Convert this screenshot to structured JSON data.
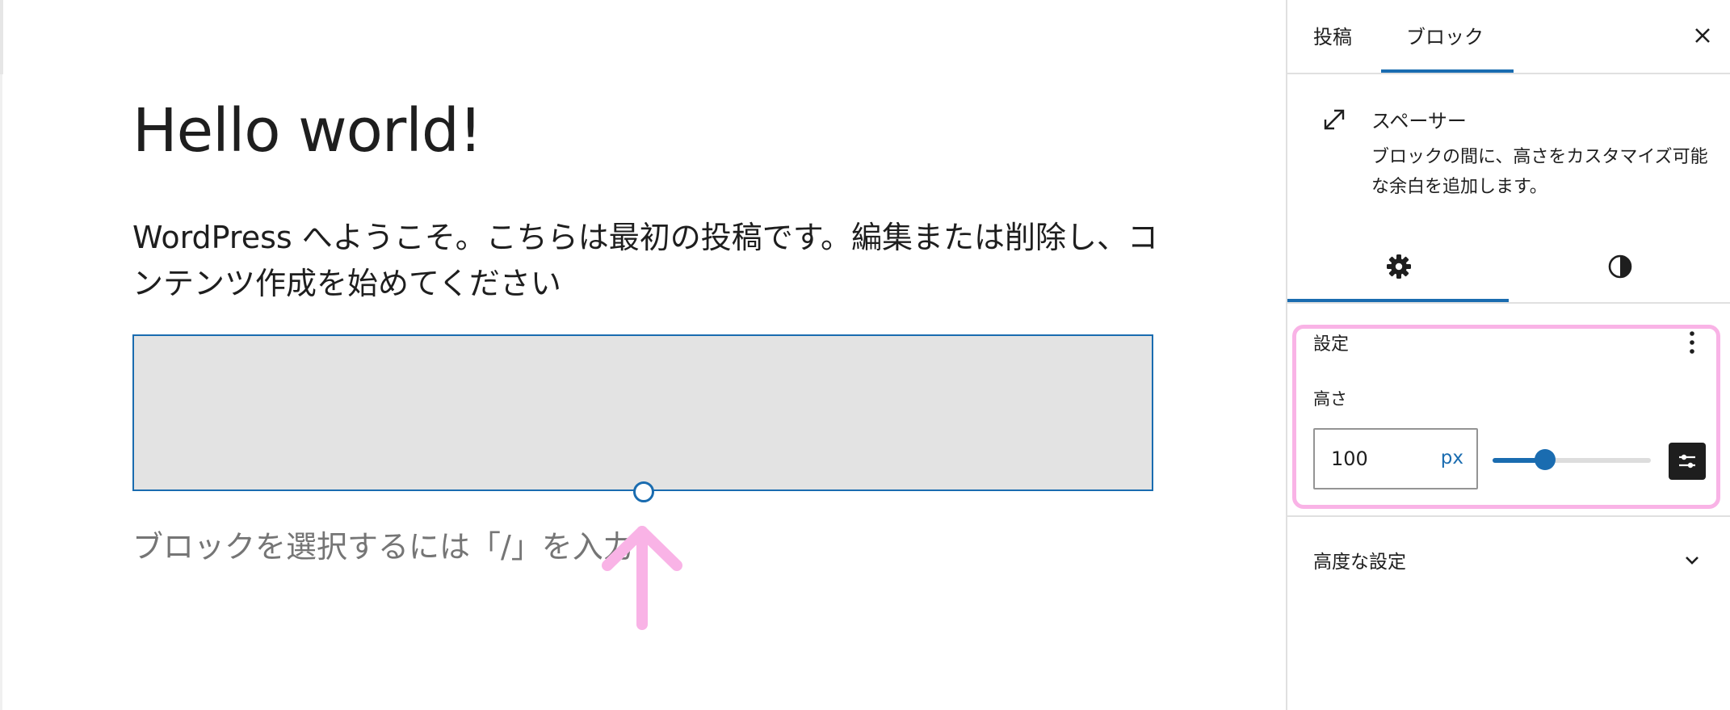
{
  "editor": {
    "post_title": "Hello world!",
    "paragraph": "WordPress へようこそ。こちらは最初の投稿です。編集または削除し、コンテンツ作成を始めてください",
    "appender_placeholder": "ブロックを選択するには「/」を入力"
  },
  "sidebar": {
    "tabs": [
      {
        "label": "投稿"
      },
      {
        "label": "ブロック",
        "active": true
      }
    ],
    "block_card": {
      "icon": "resize-arrows-icon",
      "name": "スペーサー",
      "description": "ブロックの間に、高さをカスタマイズ可能な余白を追加します。"
    },
    "inspector_tabs": [
      {
        "icon": "gear-icon",
        "active": true
      },
      {
        "icon": "contrast-icon"
      }
    ],
    "settings_panel": {
      "title": "設定",
      "height_label": "高さ",
      "height_value": "100",
      "unit": "px",
      "slider_fraction": 0.33
    },
    "advanced_panel": {
      "title": "高度な設定"
    }
  },
  "colors": {
    "accent": "#1a6cb0",
    "annotation": "#f9b3e6",
    "spacer_fill": "#e3e3e3"
  }
}
